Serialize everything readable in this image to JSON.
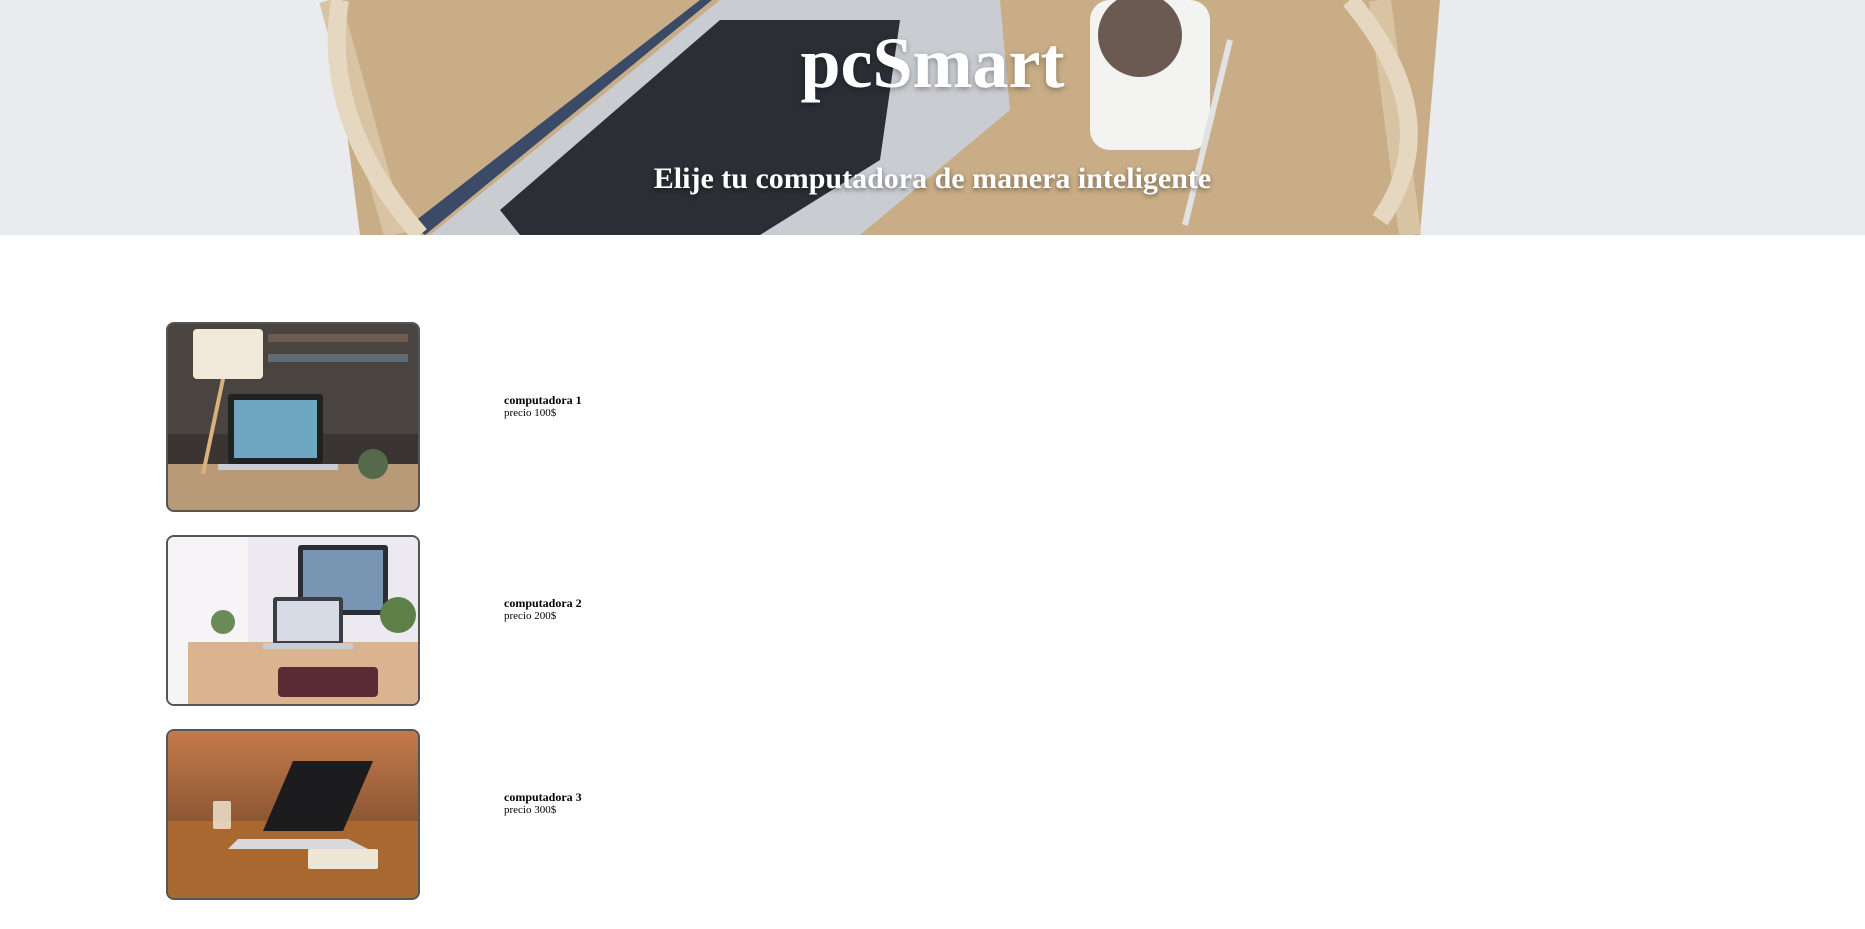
{
  "hero": {
    "title": "pcSmart",
    "subtitle": "Elije tu computadora de manera inteligente"
  },
  "products": [
    {
      "name": "computadora 1",
      "price": "precio 100$",
      "image": "laptop-on-desk-with-lamp-photo"
    },
    {
      "name": "computadora 2",
      "price": "precio 200$",
      "image": "laptop-and-monitor-workspace-photo"
    },
    {
      "name": "computadora 3",
      "price": "precio 300$",
      "image": "laptop-on-wooden-table-photo"
    }
  ]
}
